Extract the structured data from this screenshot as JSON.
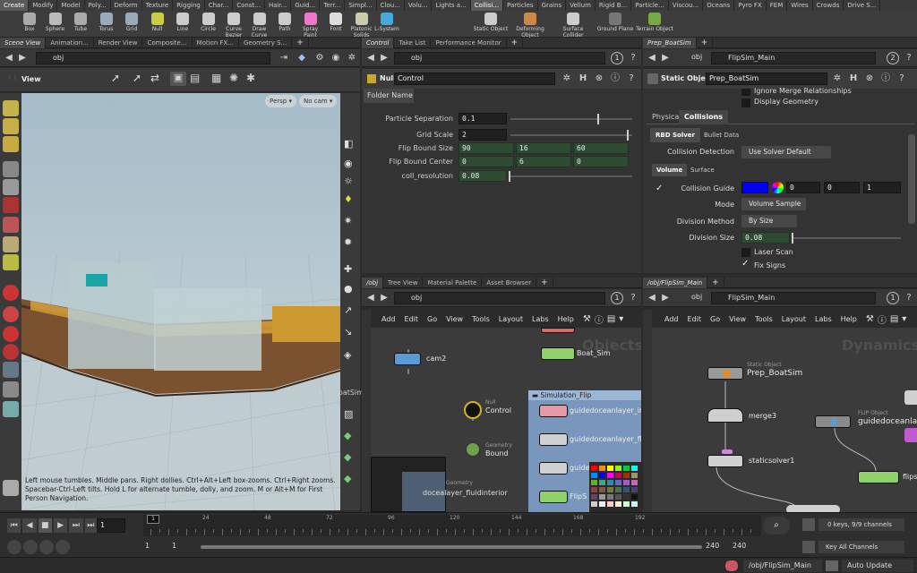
{
  "shelf_tabs": [
    "Create",
    "Modify",
    "Model",
    "Poly...",
    "Deform",
    "Texture",
    "Rigging",
    "Char...",
    "Const...",
    "Hair...",
    "Guid...",
    "Terr...",
    "Simpl...",
    "Clou...",
    "Volu...",
    "Lights a...",
    "Collisi...",
    "Particles",
    "Grains",
    "Vellum",
    "Rigid B...",
    "Particle...",
    "Viscou...",
    "Oceans",
    "Pyro FX",
    "FEM",
    "Wires",
    "Crowds",
    "Drive S..."
  ],
  "tools": [
    "Box",
    "Sphere",
    "Tube",
    "Torus",
    "Grid",
    "Null",
    "Line",
    "Circle",
    "Curve Bezier",
    "Draw Curve",
    "Path",
    "Spray Paint",
    "Font",
    "Platonic Solids",
    "L-System"
  ],
  "tools2": [
    "Static Object",
    "Deforming Object",
    "Surface Collider",
    "Ground Plane",
    "Terrain Object"
  ],
  "left": {
    "tabs": [
      "Scene View",
      "Animation...",
      "Render View",
      "Composite...",
      "Motion FX...",
      "Geometry S..."
    ],
    "path": "obj",
    "view_label": "View",
    "persp": "Persp",
    "cam": "No cam",
    "help": "Left mouse tumbles. Middle pans. Right dollies. Ctrl+Alt+Left box-zooms. Ctrl+Right zooms. Spacebar-Ctrl-Left tilts. Hold L for alternate tumble, dolly, and zoom.    M or Alt+M for First Person Navigation.",
    "side_text": "oatSim"
  },
  "params": {
    "tabs": [
      "Control",
      "Take List",
      "Performance Monitor"
    ],
    "path": "obj",
    "pane_num": "1",
    "node_type": "Null",
    "node_name": "Control",
    "folder": "Folder Name",
    "rows": [
      {
        "label": "Particle Separation",
        "values": [
          "0.1"
        ],
        "slider": 0.73
      },
      {
        "label": "Grid Scale",
        "values": [
          "2"
        ],
        "slider": 0.97
      },
      {
        "label": "Flip Bound Size",
        "values": [
          "90",
          "16",
          "60"
        ]
      },
      {
        "label": "Flip Bound Center",
        "values": [
          "0",
          "6",
          "0"
        ]
      },
      {
        "label": "coll_resolution",
        "values": [
          "0.08"
        ],
        "slider": 0.0
      }
    ]
  },
  "right": {
    "tabs": [
      "Prep_BoatSim"
    ],
    "path": "obj",
    "node": "FlipSim_Main",
    "pane_num": "2",
    "node_type": "Static Object",
    "node_name": "Prep_BoatSim",
    "top_items": [
      "Ignore Merge Relationships",
      "Display Geometry"
    ],
    "tabs1": [
      "Physical",
      "Collisions"
    ],
    "tabs2": [
      "RBD Solver",
      "Bullet Data"
    ],
    "detection_label": "Collision Detection",
    "detection_value": "Use Solver Default",
    "tabs3": [
      "Volume",
      "Surface"
    ],
    "guide_label": "Collision Guide",
    "guide_values": [
      "0",
      "0",
      "1"
    ],
    "mode_label": "Mode",
    "mode_value": "Volume Sample",
    "division_method_label": "Division Method",
    "division_method_value": "By Size",
    "division_size_label": "Division Size",
    "division_size_value": "0.08",
    "laser_scan": "Laser Scan",
    "fix_signs": "Fix Signs"
  },
  "net_mid": {
    "tabs": [
      "/obj",
      "Tree View",
      "Material Palette",
      "Asset Browser"
    ],
    "path": "obj",
    "pane_num": "1",
    "menu": [
      "Add",
      "Edit",
      "Go",
      "View",
      "Tools",
      "Layout",
      "Labs",
      "Help"
    ],
    "watermark": "Objects",
    "nodes": {
      "cam2": "cam2",
      "boat_sim": "Boat_Sim",
      "control_type": "Null",
      "control": "Control",
      "bound_type": "Geometry",
      "bound": "Bound",
      "box_title": "Simulation_Flip",
      "g1": "guidedoceanlayer_init",
      "g2": "guidedoceanlayer_flui",
      "g3": "guidedoceanlay",
      "g4": "FlipS",
      "interior": "docealayer_fluidinterior",
      "interior_type": "Geometry"
    }
  },
  "net_right": {
    "tabs": [
      "/obj/FlipSim_Main"
    ],
    "path": "obj",
    "node": "FlipSim_Main",
    "pane_num": "1",
    "menu": [
      "Add",
      "Edit",
      "Go",
      "View",
      "Tools",
      "Layout",
      "Labs",
      "Help"
    ],
    "watermark": "Dynamics",
    "nodes": {
      "static_type": "Static Object",
      "static": "Prep_BoatSim",
      "merge": "merge3",
      "solver": "staticsolver1",
      "flip_type": "FLIP Object",
      "flip": "guidedoceanlaye",
      "flip2": "flips"
    }
  },
  "timeline": {
    "frame": "1",
    "ticks": [
      "24",
      "48",
      "72",
      "96",
      "120",
      "144",
      "168",
      "192"
    ],
    "start": "1",
    "start2": "1",
    "end": "240",
    "end2": "240",
    "keys": "0 keys, 9/9 channels",
    "key_all": "Key All Channels"
  },
  "status": {
    "path": "/obj/FlipSim_Main",
    "update": "Auto Update"
  }
}
